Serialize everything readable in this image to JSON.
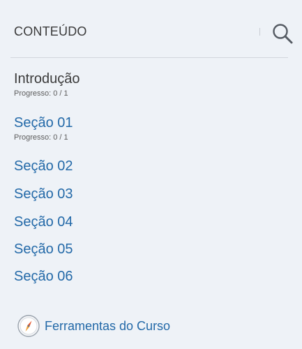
{
  "header": {
    "title": "CONTEÚDO"
  },
  "sections": [
    {
      "label": "Introdução",
      "progress": "Progresso: 0 / 1"
    },
    {
      "label": "Seção 01",
      "progress": "Progresso: 0 / 1"
    },
    {
      "label": "Seção 02"
    },
    {
      "label": "Seção 03"
    },
    {
      "label": "Seção 04"
    },
    {
      "label": "Seção 05"
    },
    {
      "label": "Seção 06"
    }
  ],
  "footer": {
    "tools_label": "Ferramentas do Curso",
    "tools_icon": "compass-icon"
  },
  "colors": {
    "link": "#2369a8",
    "heading": "#3a3a3a",
    "panel_bg": "#eef2f7"
  }
}
